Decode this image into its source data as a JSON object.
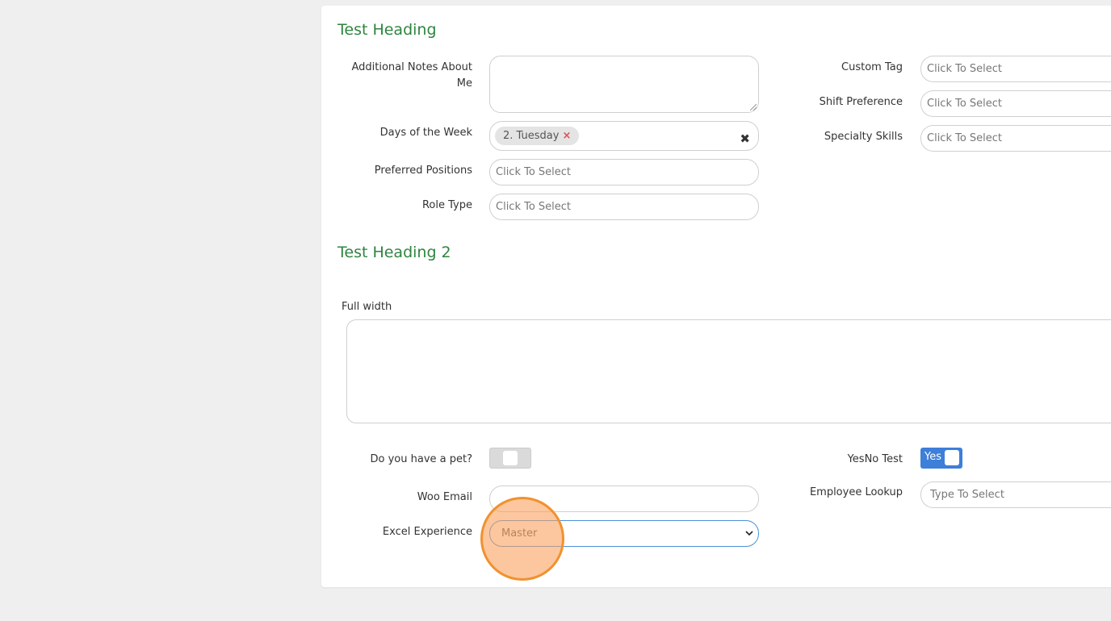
{
  "section1": {
    "heading": "Test Heading",
    "fields": {
      "notes": {
        "label": "Additional Notes About Me",
        "value": ""
      },
      "days": {
        "label": "Days of the Week",
        "chip": "2. Tuesday",
        "chip_remove": "×",
        "clear": "✖"
      },
      "positions": {
        "label": "Preferred Positions",
        "placeholder": "Click To Select"
      },
      "role": {
        "label": "Role Type",
        "placeholder": "Click To Select"
      },
      "custom_tag": {
        "label": "Custom Tag",
        "placeholder": "Click To Select"
      },
      "shift": {
        "label": "Shift Preference",
        "placeholder": "Click To Select"
      },
      "skills": {
        "label": "Specialty Skills",
        "placeholder": "Click To Select"
      }
    }
  },
  "section2": {
    "heading": "Test Heading 2",
    "full_width": {
      "label": "Full width",
      "value": ""
    },
    "fields": {
      "pet": {
        "label": "Do you have a pet?",
        "checked": false
      },
      "yesno": {
        "label": "YesNo Test",
        "on_text": "Yes",
        "checked": true
      },
      "woo_email": {
        "label": "Woo Email",
        "value": ""
      },
      "employee_lookup": {
        "label": "Employee Lookup",
        "placeholder": "Type To Select"
      },
      "excel": {
        "label": "Excel Experience",
        "selected": "Master",
        "chevron": "⌄"
      }
    }
  },
  "colors": {
    "heading": "#2e8540",
    "toggle_on": "#3d7fd9",
    "click_marker": "#f0922e",
    "chip_remove": "#d9534f"
  }
}
